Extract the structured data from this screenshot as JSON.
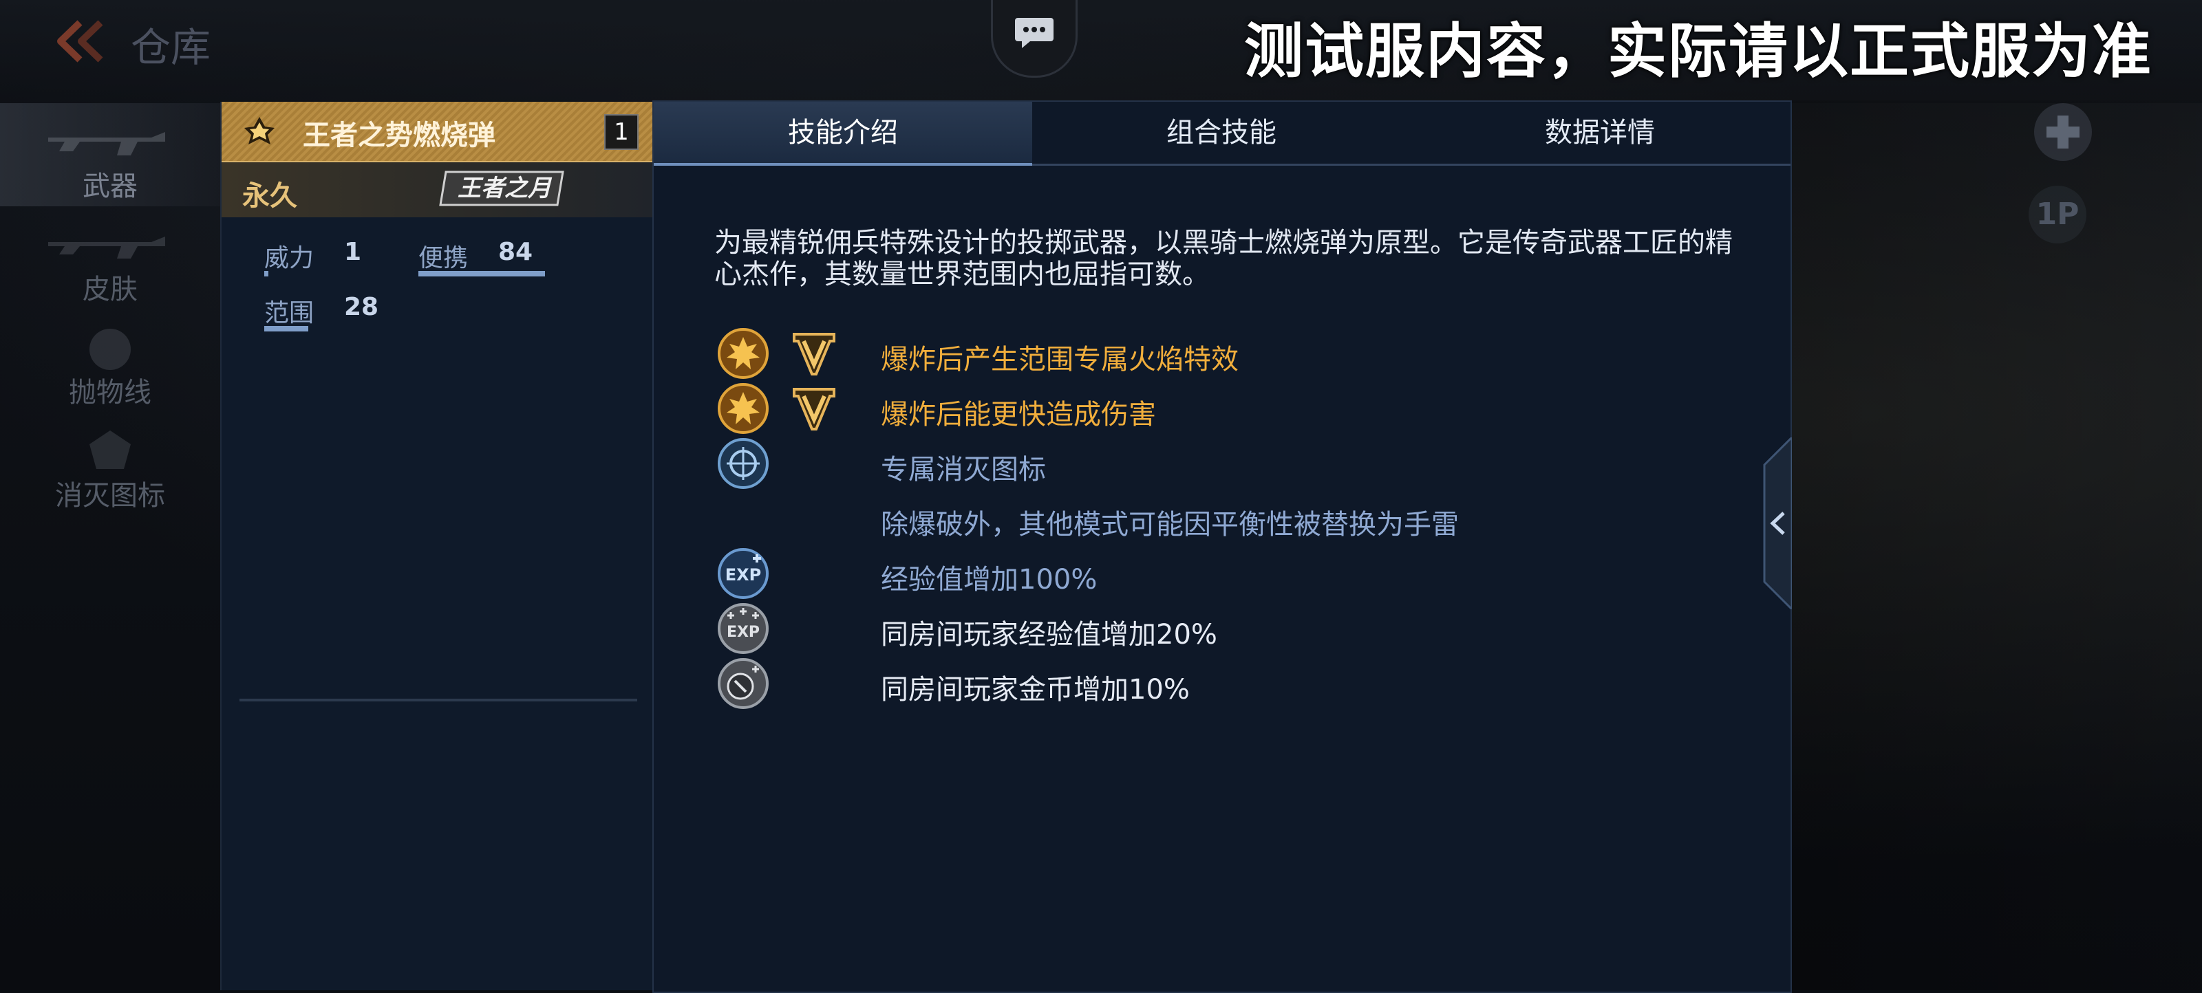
{
  "header": {
    "title": "仓库",
    "watermark": "测试服内容，实际请以正式服为准"
  },
  "sidebar": {
    "items": [
      {
        "label": "武器",
        "icon": "rifle-icon",
        "active": true
      },
      {
        "label": "皮肤",
        "icon": "skin-icon",
        "active": false
      },
      {
        "label": "抛物线",
        "icon": "trajectory-icon",
        "active": false
      },
      {
        "label": "消灭图标",
        "icon": "kill-icon",
        "active": false
      }
    ]
  },
  "item": {
    "name": "王者之势燃烧弹",
    "quantity": "1",
    "duration": "永久",
    "series_logo": "王者之月",
    "stats": [
      {
        "label": "威力",
        "value": "1"
      },
      {
        "label": "便携",
        "value": "84"
      },
      {
        "label": "范围",
        "value": "28"
      }
    ],
    "colors": {
      "header_gold": "#b98e44",
      "duration_gold": "#e6c27a"
    }
  },
  "tabs": [
    {
      "label": "技能介绍",
      "active": true
    },
    {
      "label": "组合技能",
      "active": false
    },
    {
      "label": "数据详情",
      "active": false
    }
  ],
  "description": "为最精锐佣兵特殊设计的投掷武器，以黑骑士燃烧弹为原型。它是传奇武器工匠的精心杰作，其数量世界范围内也屈指可数。",
  "skills": [
    {
      "text": "爆炸后产生范围专属火焰特效",
      "icon": "explosion-icon",
      "badge": "v-rank-icon",
      "color": "#f1ae3c"
    },
    {
      "text": "爆炸后能更快造成伤害",
      "icon": "explosion-icon",
      "badge": "v-rank-icon",
      "color": "#f1ae3c"
    },
    {
      "text": "专属消灭图标",
      "icon": "kill-mark-icon",
      "badge": "",
      "color": "#8fa9d3"
    },
    {
      "text": "除爆破外，其他模式可能因平衡性被替换为手雷",
      "icon": "",
      "badge": "",
      "color": "#8fa9d3"
    },
    {
      "text": "经验值增加100%",
      "icon": "exp-icon",
      "badge": "",
      "color": "#8fa9d3"
    },
    {
      "text": "同房间玩家经验值增加20%",
      "icon": "room-exp-icon",
      "badge": "",
      "color": "#e6ebf4"
    },
    {
      "text": "同房间玩家金币增加10%",
      "icon": "room-coin-icon",
      "badge": "",
      "color": "#e6ebf4"
    }
  ],
  "right_controls": {
    "second_label": "1P"
  }
}
